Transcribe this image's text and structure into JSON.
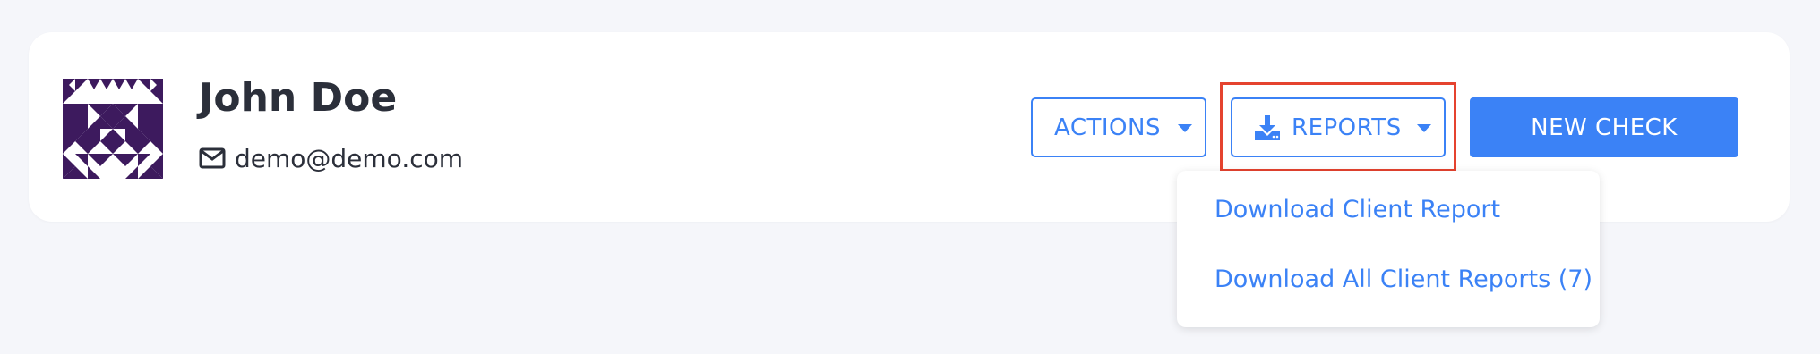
{
  "profile": {
    "name": "John Doe",
    "email": "demo@demo.com"
  },
  "toolbar": {
    "actions_label": "ACTIONS",
    "reports_label": "REPORTS",
    "new_check_label": "NEW CHECK"
  },
  "reports_menu": {
    "items": [
      {
        "label": "Download Client Report"
      },
      {
        "label": "Download All Client Reports (7)"
      }
    ]
  },
  "colors": {
    "accent": "#3b82f6",
    "avatar": "#3d1a5e",
    "highlight": "#e5432f",
    "text": "#2b2f3a",
    "background": "#f5f6fa"
  },
  "icons": {
    "email": "envelope-icon",
    "reports": "download-icon",
    "dropdown": "caret-down-icon"
  }
}
